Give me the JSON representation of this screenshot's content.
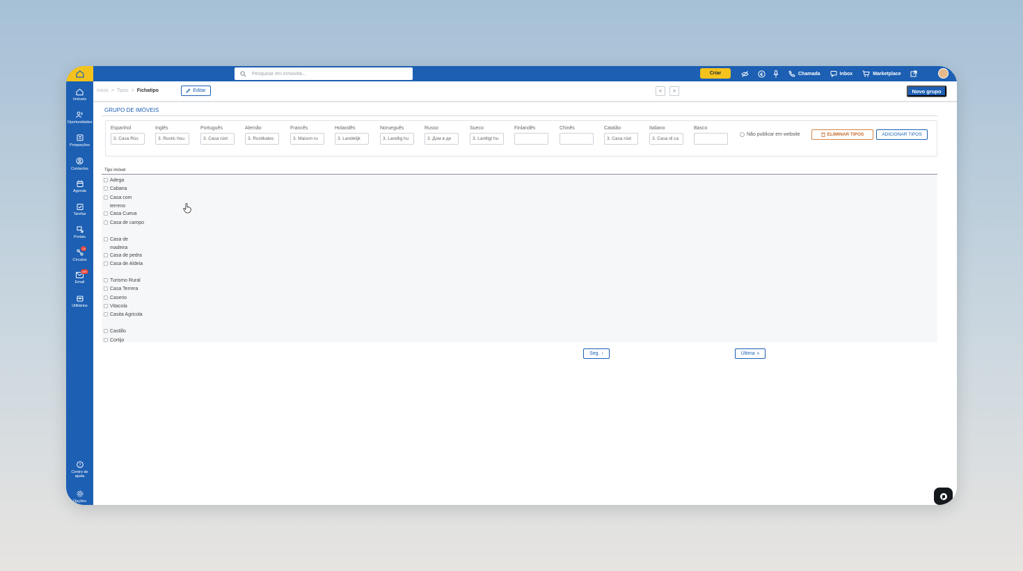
{
  "topbar": {
    "search_placeholder": "Pesquisar em inmovilla...",
    "criar_label": "Criar",
    "chamada_label": "Chamada",
    "inbox_label": "Inbox",
    "marketplace_label": "Marketplace"
  },
  "sidebar": {
    "items": [
      {
        "label": "Imóveis",
        "icon": "home-icon"
      },
      {
        "label": "Oportunidades",
        "icon": "users-icon"
      },
      {
        "label": "Prospeções",
        "icon": "list-icon"
      },
      {
        "label": "Contactos",
        "icon": "contact-icon"
      },
      {
        "label": "Agenda",
        "icon": "calendar-icon"
      },
      {
        "label": "Tarefas",
        "icon": "tasks-icon"
      },
      {
        "label": "Portais",
        "icon": "portals-icon"
      },
      {
        "label": "Círculos",
        "icon": "circles-icon",
        "badge": "13"
      },
      {
        "label": "Email",
        "icon": "mail-icon",
        "badge": "256"
      },
      {
        "label": "Utilitários",
        "icon": "tools-icon"
      }
    ],
    "help_label": "Centro de ajuda",
    "settings_label": "Opções"
  },
  "breadcrumb": {
    "home": "Início",
    "sep1": ">",
    "tipos": "Tipos",
    "sep2": ">",
    "current": "Fichatipo"
  },
  "toolbar": {
    "edit_label": "Editar",
    "prev_label": "<",
    "next_label": ">",
    "new_group_label": "Novo grupo"
  },
  "group": {
    "title": "GRUPO DE IMÓVEIS",
    "languages": [
      {
        "name": "Espanhol",
        "value": "3. Casa Rús"
      },
      {
        "name": "Inglês",
        "value": "3. Rustic hou"
      },
      {
        "name": "Português",
        "value": "3. Casa rúst"
      },
      {
        "name": "Alemão",
        "value": "3. Rustikales"
      },
      {
        "name": "Francês",
        "value": "3. Maison ru"
      },
      {
        "name": "Holandês",
        "value": "3. Landelijk"
      },
      {
        "name": "Norueguês",
        "value": "3. Landlig hu"
      },
      {
        "name": "Russo",
        "value": "3. Дом в де"
      },
      {
        "name": "Sueco",
        "value": "3. Lantligt hu"
      },
      {
        "name": "Finlandês",
        "value": ""
      },
      {
        "name": "Chinês",
        "value": ""
      },
      {
        "name": "Catalão",
        "value": "3. Casa rúst"
      },
      {
        "name": "Italiano",
        "value": "3. Casa di ca"
      },
      {
        "name": "Basco",
        "value": ""
      }
    ],
    "no_publish_label": "Não publicar em website",
    "delete_types_label": "ELIMINAR TIPOS",
    "add_types_label": "ADICIONAR TIPOS"
  },
  "list": {
    "header": "Tipo imóvel",
    "items": [
      "Adega",
      "Cabana",
      "Casa com terreno",
      "Casa Cueva",
      "Casa de campo",
      "Casa de madeira",
      "Casa de pedra",
      "Casa de Aldeia",
      "Turismo Rural",
      "Casa Terrera",
      "Caserio",
      "Vitacola",
      "Casita Agricola",
      "Castillo",
      "Cortijo"
    ]
  },
  "pager": {
    "next_label": "Seg.",
    "last_label": "Última"
  },
  "colors": {
    "brand_blue": "#1c5fb3",
    "accent_yellow": "#f3c21d",
    "danger_orange": "#c46a2d"
  }
}
